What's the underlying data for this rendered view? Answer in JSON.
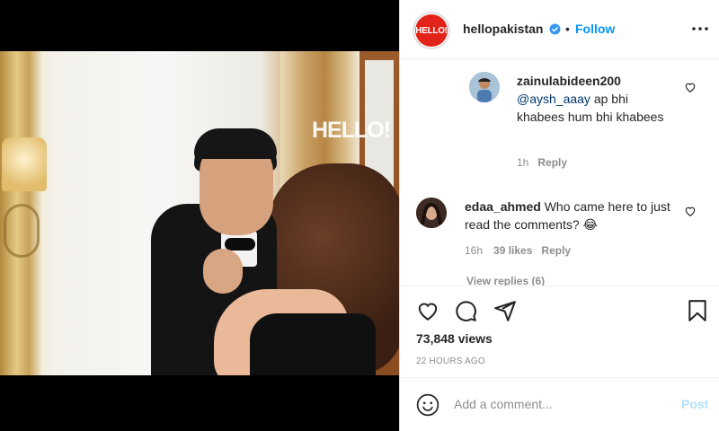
{
  "media": {
    "watermark": "HELLO!",
    "mute_icon": "speaker-muted-icon"
  },
  "header": {
    "avatar_text": "HELLO!",
    "username": "hellopakistan",
    "verified_icon": "verified-badge-icon",
    "separator": "•",
    "follow_label": "Follow",
    "more_icon": "more-horizontal-icon"
  },
  "comments": [
    {
      "username": "zainulabideen200",
      "mention": "@aysh_aaay",
      "text": " ap bhi khabees hum bhi khabees",
      "time": "1h",
      "reply_label": "Reply"
    },
    {
      "username": "edaa_ahmed",
      "text": " Who came here to just read the comments? 😂",
      "time": "16h",
      "likes": "39 likes",
      "reply_label": "Reply"
    }
  ],
  "view_replies": "View replies (6)",
  "actions": {
    "like_icon": "heart-icon",
    "comment_icon": "comment-icon",
    "share_icon": "share-icon",
    "save_icon": "bookmark-icon"
  },
  "stats": {
    "views": "73,848 views",
    "timestamp": "22 HOURS AGO"
  },
  "add_comment": {
    "emoji_icon": "smiley-icon",
    "placeholder": "Add a comment...",
    "post_label": "Post"
  },
  "colors": {
    "accent": "#0095f6",
    "brand": "#e2231a",
    "muted": "#8e8e8e",
    "post_disabled": "#b2dffc"
  }
}
